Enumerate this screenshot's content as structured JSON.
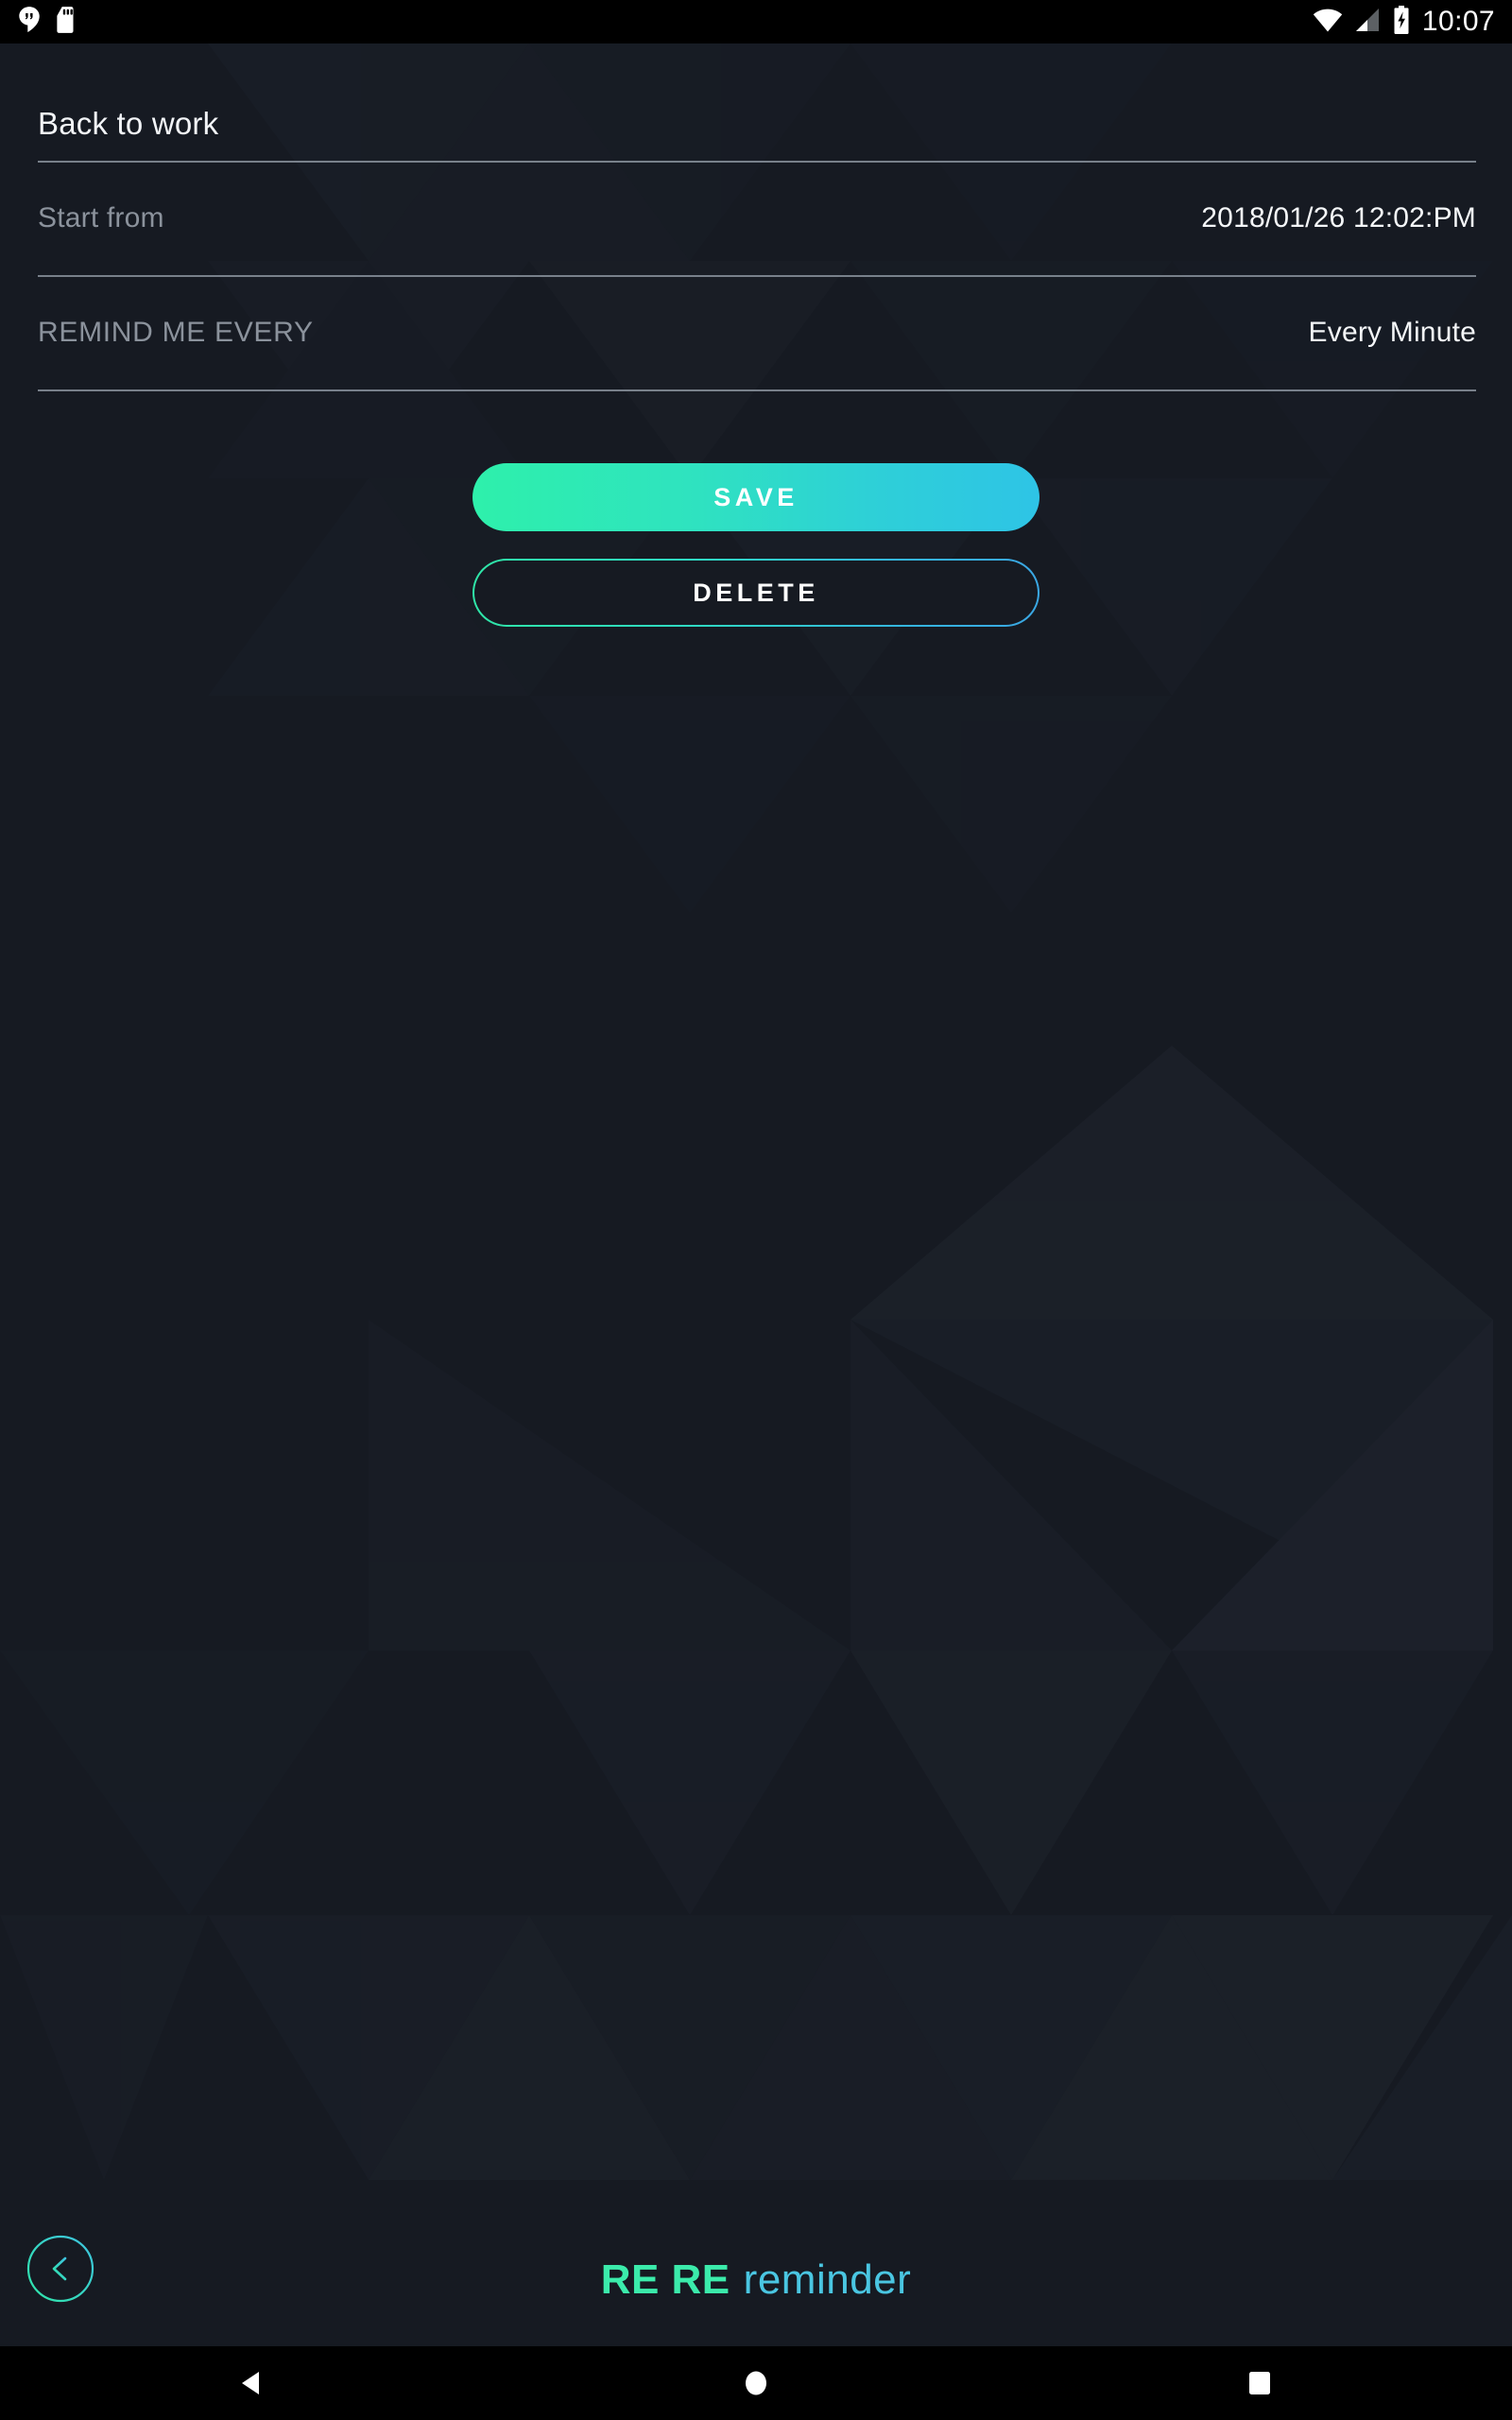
{
  "statusbar": {
    "time": "10:07",
    "left_icons": [
      {
        "name": "hangouts-icon",
        "label": "Hangouts"
      },
      {
        "name": "sd-card-icon",
        "label": "SD card"
      }
    ],
    "right_icons": [
      {
        "name": "wifi-icon",
        "label": "Wi-Fi"
      },
      {
        "name": "cellular-signal-icon",
        "label": "Cellular signal"
      },
      {
        "name": "battery-charging-icon",
        "label": "Battery charging"
      }
    ]
  },
  "header": {
    "title": "Back to work"
  },
  "form": {
    "start_from": {
      "label": "Start from",
      "value": "2018/01/26 12:02:PM"
    },
    "remind_me_every": {
      "label": "REMIND ME EVERY",
      "value": "Every Minute"
    }
  },
  "actions": {
    "save_label": "SAVE",
    "delete_label": "DELETE"
  },
  "footer": {
    "back_icon": "chevron-left-icon",
    "brand_mark": "RE RE",
    "brand_word": "reminder"
  },
  "navbar": {
    "back_label": "Back",
    "home_label": "Home",
    "recents_label": "Recents"
  },
  "colors": {
    "background": "#161a22",
    "statusbar_bg": "#000000",
    "navbar_bg": "#000000",
    "accent_green": "#2ef0ab",
    "accent_blue": "#2ec4e6",
    "brand_green": "#3bebab",
    "brand_blue": "#4ac6e2",
    "text_primary": "#f4f6f8",
    "text_secondary": "#8b929c",
    "divider": "#9aa3ad"
  }
}
